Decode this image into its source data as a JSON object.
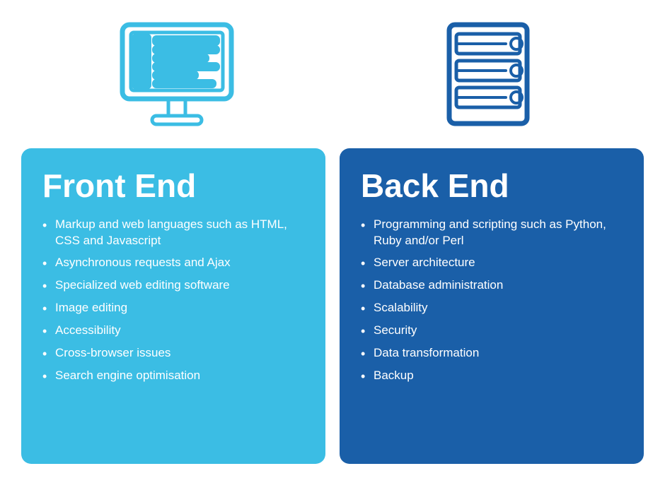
{
  "icons": {
    "monitor_label": "monitor icon",
    "server_label": "server icon"
  },
  "front_end": {
    "title": "Front End",
    "items": [
      "Markup and web languages such as HTML, CSS and Javascript",
      "Asynchronous requests and Ajax",
      "Specialized web editing software",
      "Image editing",
      "Accessibility",
      "Cross-browser issues",
      "Search engine optimisation"
    ]
  },
  "back_end": {
    "title": "Back End",
    "items": [
      "Programming and scripting such as Python, Ruby and/or Perl",
      "Server architecture",
      "Database administration",
      "Scalability",
      "Security",
      "Data transformation",
      "Backup"
    ]
  }
}
